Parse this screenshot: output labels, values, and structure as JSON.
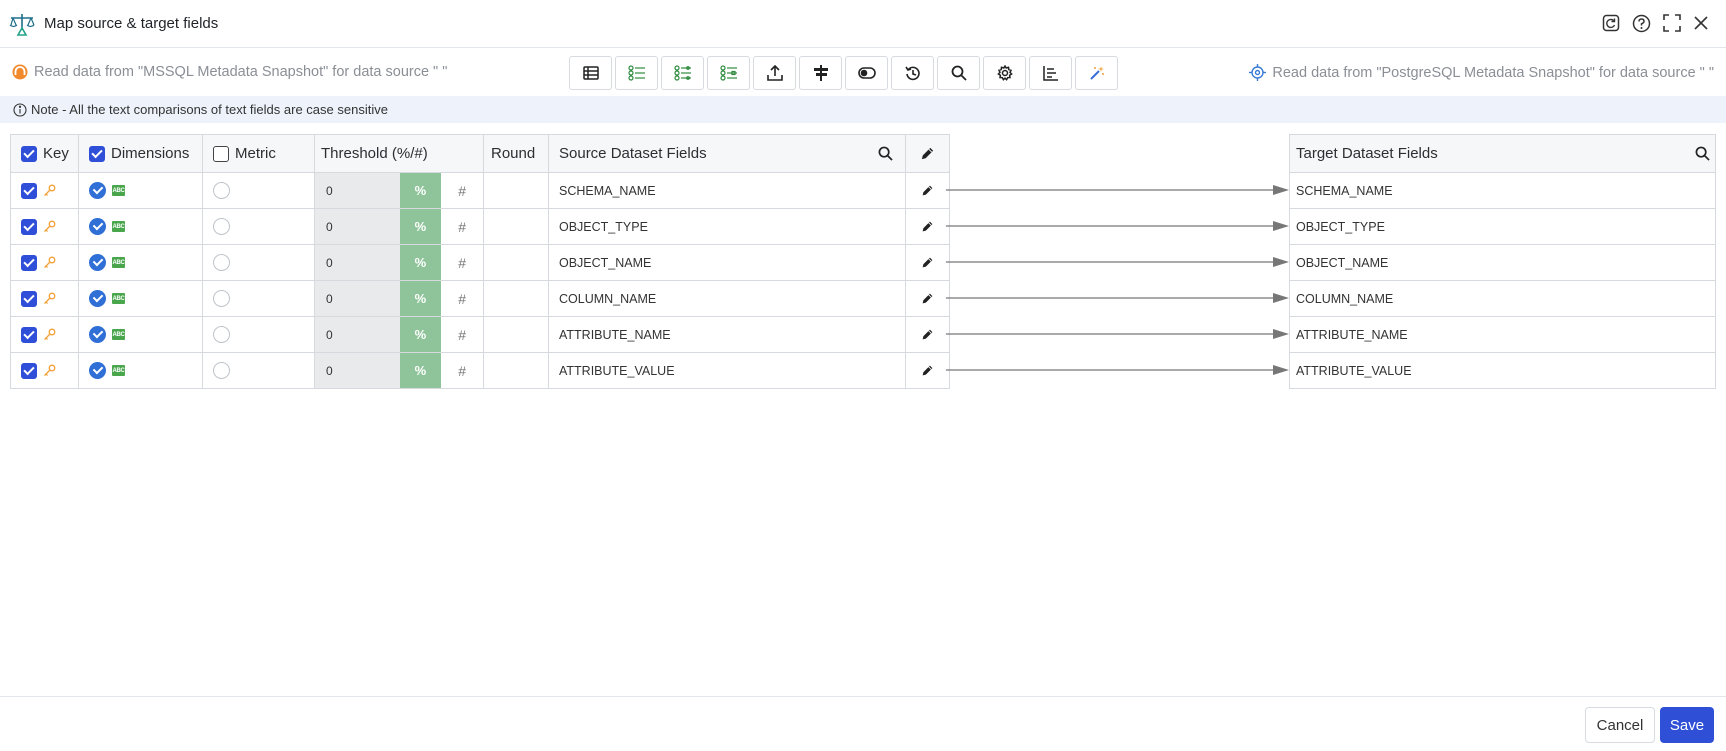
{
  "window": {
    "title": "Map source & target fields"
  },
  "source_label": "Read data from \"MSSQL Metadata Snapshot\" for data source \" \"",
  "target_label": "Read data from \"PostgreSQL Metadata Snapshot\" for data source \" \"",
  "toolbar": {
    "icons": [
      "table-icon",
      "list-check-icon",
      "list-compare-icon",
      "list-settings-icon",
      "upload-icon",
      "signpost-icon",
      "toggle-icon",
      "history-icon",
      "search-icon",
      "gear-icon",
      "chart-axis-icon",
      "magic-wand-icon"
    ]
  },
  "note": "Note - All the text comparisons of text fields are case sensitive",
  "columns": {
    "key": "Key",
    "dimensions": "Dimensions",
    "metric": "Metric",
    "threshold": "Threshold (%/#)",
    "round": "Round",
    "source_fields": "Source Dataset Fields",
    "target_fields": "Target Dataset Fields"
  },
  "header_checks": {
    "key": true,
    "dimensions": true,
    "metric": false
  },
  "rows": [
    {
      "key": true,
      "dimension": true,
      "metric": false,
      "threshold": "0",
      "pct": "%",
      "hash": "#",
      "round": "",
      "source": "SCHEMA_NAME",
      "target": "SCHEMA_NAME"
    },
    {
      "key": true,
      "dimension": true,
      "metric": false,
      "threshold": "0",
      "pct": "%",
      "hash": "#",
      "round": "",
      "source": "OBJECT_TYPE",
      "target": "OBJECT_TYPE"
    },
    {
      "key": true,
      "dimension": true,
      "metric": false,
      "threshold": "0",
      "pct": "%",
      "hash": "#",
      "round": "",
      "source": "OBJECT_NAME",
      "target": "OBJECT_NAME"
    },
    {
      "key": true,
      "dimension": true,
      "metric": false,
      "threshold": "0",
      "pct": "%",
      "hash": "#",
      "round": "",
      "source": "COLUMN_NAME",
      "target": "COLUMN_NAME"
    },
    {
      "key": true,
      "dimension": true,
      "metric": false,
      "threshold": "0",
      "pct": "%",
      "hash": "#",
      "round": "",
      "source": "ATTRIBUTE_NAME",
      "target": "ATTRIBUTE_NAME"
    },
    {
      "key": true,
      "dimension": true,
      "metric": false,
      "threshold": "0",
      "pct": "%",
      "hash": "#",
      "round": "",
      "source": "ATTRIBUTE_VALUE",
      "target": "ATTRIBUTE_VALUE"
    }
  ],
  "footer": {
    "cancel_label": "Cancel",
    "save_label": "Save"
  },
  "colors": {
    "accent": "#2e4fd6",
    "threshold_pct": "#8fc49a",
    "dimension_badge": "#4aa64c",
    "key_icon": "#f0a238"
  }
}
